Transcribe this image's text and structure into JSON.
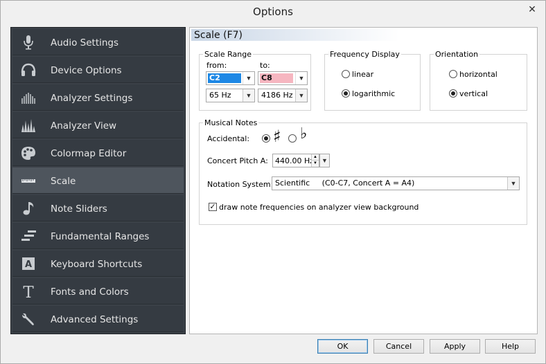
{
  "window": {
    "title": "Options",
    "close_glyph": "✕"
  },
  "sidebar": {
    "items": [
      {
        "label": "Audio Settings",
        "icon": "microphone-icon"
      },
      {
        "label": "Device Options",
        "icon": "headphones-icon"
      },
      {
        "label": "Analyzer Settings",
        "icon": "analyzer-settings-icon"
      },
      {
        "label": "Analyzer View",
        "icon": "analyzer-view-icon"
      },
      {
        "label": "Colormap Editor",
        "icon": "palette-icon"
      },
      {
        "label": "Scale",
        "icon": "ruler-icon",
        "active": true
      },
      {
        "label": "Note Sliders",
        "icon": "music-note-icon"
      },
      {
        "label": "Fundamental Ranges",
        "icon": "ranges-icon"
      },
      {
        "label": "Keyboard Shortcuts",
        "icon": "keyboard-key-icon"
      },
      {
        "label": "Fonts and Colors",
        "icon": "font-icon"
      },
      {
        "label": "Advanced Settings",
        "icon": "wrench-icon"
      }
    ]
  },
  "panel": {
    "title": "Scale (F7)",
    "scale_range": {
      "label": "Scale Range",
      "from_label": "from:",
      "to_label": "to:",
      "from_note": "C2",
      "to_note": "C8",
      "from_freq": "65 Hz",
      "to_freq": "4186 Hz",
      "from_color": "#1e88e5",
      "to_color": "#f6b6c0"
    },
    "frequency_display": {
      "label": "Frequency Display",
      "linear": "linear",
      "logarithmic": "logarithmic",
      "selected": "logarithmic"
    },
    "orientation": {
      "label": "Orientation",
      "horizontal": "horizontal",
      "vertical": "vertical",
      "selected": "vertical"
    },
    "musical_notes": {
      "label": "Musical Notes",
      "accidental_label": "Accidental:",
      "sharp_symbol": "♯",
      "flat_symbol": "♭",
      "accidental_selected": "sharp",
      "concert_pitch_label": "Concert Pitch A:",
      "concert_pitch_value": "440.00 Hz",
      "notation_label": "Notation System:",
      "notation_value": "Scientific     (C0-C7, Concert A = A4)",
      "draw_frequencies_label": "draw note frequencies on analyzer view background",
      "draw_frequencies_checked": true,
      "check_glyph": "✓"
    }
  },
  "buttons": {
    "ok": "OK",
    "cancel": "Cancel",
    "apply": "Apply",
    "help": "Help"
  }
}
